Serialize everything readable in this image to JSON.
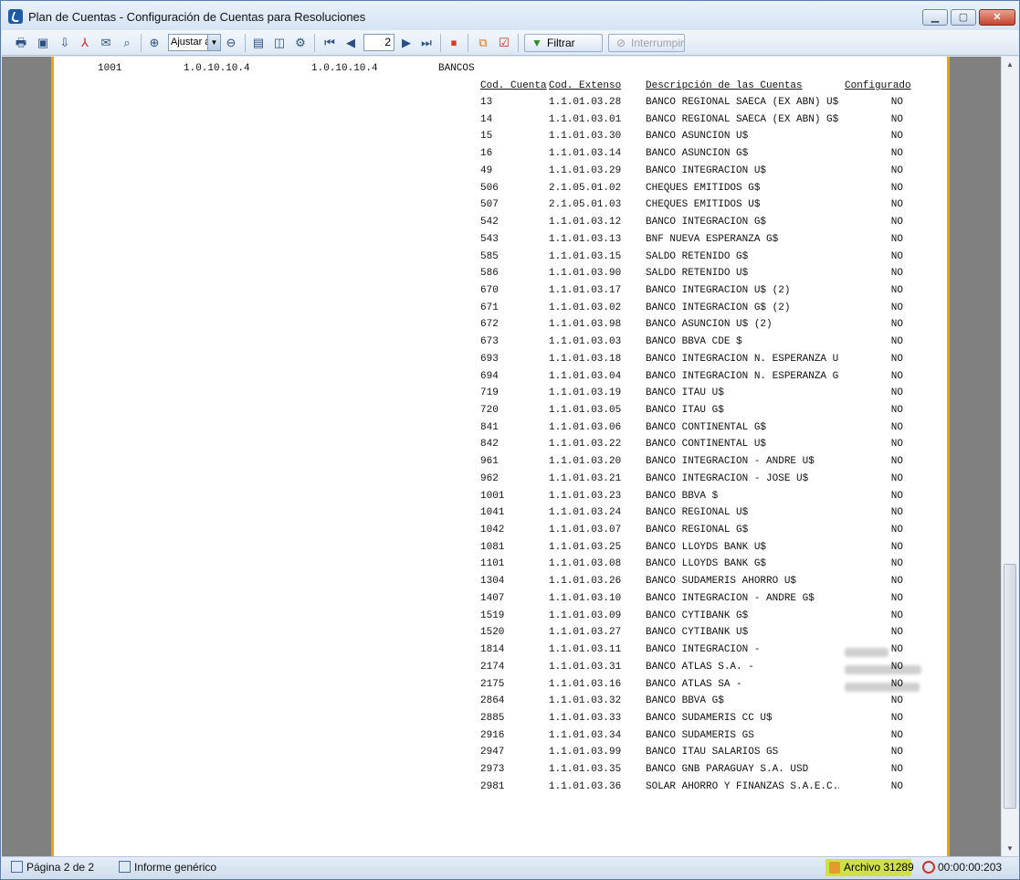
{
  "window": {
    "title": "Plan de Cuentas - Configuración de Cuentas para Resoluciones",
    "min_label": "▁",
    "max_label": "▢",
    "close_label": "✕"
  },
  "toolbar": {
    "zoom_value": "Ajustar a",
    "page_value": "2",
    "filter_label": "Filtrar",
    "interrupt_label": "Interrumpir",
    "icons": [
      "print-icon",
      "save-icon",
      "export-icon",
      "pdf-icon",
      "email-icon",
      "find-icon",
      "zoom-in-icon",
      "zoom-out-icon",
      "single-page-icon",
      "two-page-icon",
      "settings-icon",
      "first-page-icon",
      "previous-page-icon",
      "next-page-icon",
      "last-page-icon",
      "stop-icon",
      "copy-icon",
      "check-icon",
      "filter-icon",
      "interrupt-icon"
    ]
  },
  "report": {
    "group": {
      "code": "1001",
      "ext1": "1.0.10.10.4",
      "ext2": "1.0.10.10.4",
      "name": "BANCOS"
    },
    "headers": {
      "code": "Cod. Cuenta",
      "ext": "Cod. Extenso",
      "desc": "Descripción de las Cuentas",
      "conf": "Configurado"
    },
    "rows": [
      {
        "code": "13",
        "ext": "1.1.01.03.28",
        "desc": "BANCO REGIONAL SAECA (EX ABN) U$",
        "conf": "NO"
      },
      {
        "code": "14",
        "ext": "1.1.01.03.01",
        "desc": "BANCO REGIONAL SAECA (EX ABN) G$",
        "conf": "NO"
      },
      {
        "code": "15",
        "ext": "1.1.01.03.30",
        "desc": "BANCO ASUNCION U$",
        "conf": "NO"
      },
      {
        "code": "16",
        "ext": "1.1.01.03.14",
        "desc": "BANCO ASUNCION G$",
        "conf": "NO"
      },
      {
        "code": "49",
        "ext": "1.1.01.03.29",
        "desc": "BANCO INTEGRACION U$",
        "conf": "NO"
      },
      {
        "code": "506",
        "ext": "2.1.05.01.02",
        "desc": "CHEQUES EMITIDOS G$",
        "conf": "NO"
      },
      {
        "code": "507",
        "ext": "2.1.05.01.03",
        "desc": "CHEQUES EMITIDOS U$",
        "conf": "NO"
      },
      {
        "code": "542",
        "ext": "1.1.01.03.12",
        "desc": "BANCO INTEGRACION G$",
        "conf": "NO"
      },
      {
        "code": "543",
        "ext": "1.1.01.03.13",
        "desc": "BNF NUEVA ESPERANZA G$",
        "conf": "NO"
      },
      {
        "code": "585",
        "ext": "1.1.01.03.15",
        "desc": "SALDO RETENIDO G$",
        "conf": "NO"
      },
      {
        "code": "586",
        "ext": "1.1.01.03.90",
        "desc": "SALDO RETENIDO U$",
        "conf": "NO"
      },
      {
        "code": "670",
        "ext": "1.1.01.03.17",
        "desc": "BANCO INTEGRACION U$  (2)",
        "conf": "NO"
      },
      {
        "code": "671",
        "ext": "1.1.01.03.02",
        "desc": "BANCO INTEGRACION G$  (2)",
        "conf": "NO"
      },
      {
        "code": "672",
        "ext": "1.1.01.03.98",
        "desc": "BANCO ASUNCION U$  (2)",
        "conf": "NO"
      },
      {
        "code": "673",
        "ext": "1.1.01.03.03",
        "desc": "BANCO BBVA CDE $",
        "conf": "NO"
      },
      {
        "code": "693",
        "ext": "1.1.01.03.18",
        "desc": "BANCO INTEGRACION N. ESPERANZA U$",
        "conf": "NO"
      },
      {
        "code": "694",
        "ext": "1.1.01.03.04",
        "desc": "BANCO INTEGRACION N. ESPERANZA G$",
        "conf": "NO"
      },
      {
        "code": "719",
        "ext": "1.1.01.03.19",
        "desc": "BANCO ITAU U$",
        "conf": "NO"
      },
      {
        "code": "720",
        "ext": "1.1.01.03.05",
        "desc": "BANCO ITAU G$",
        "conf": "NO"
      },
      {
        "code": "841",
        "ext": "1.1.01.03.06",
        "desc": "BANCO CONTINENTAL G$",
        "conf": "NO"
      },
      {
        "code": "842",
        "ext": "1.1.01.03.22",
        "desc": "BANCO CONTINENTAL U$",
        "conf": "NO"
      },
      {
        "code": "961",
        "ext": "1.1.01.03.20",
        "desc": "BANCO INTEGRACION - ANDRE U$",
        "conf": "NO"
      },
      {
        "code": "962",
        "ext": "1.1.01.03.21",
        "desc": "BANCO INTEGRACION - JOSÉ U$",
        "conf": "NO"
      },
      {
        "code": "1001",
        "ext": "1.1.01.03.23",
        "desc": "BANCO BBVA $",
        "conf": "NO"
      },
      {
        "code": "1041",
        "ext": "1.1.01.03.24",
        "desc": "BANCO REGIONAL U$",
        "conf": "NO"
      },
      {
        "code": "1042",
        "ext": "1.1.01.03.07",
        "desc": "BANCO REGIONAL G$",
        "conf": "NO"
      },
      {
        "code": "1081",
        "ext": "1.1.01.03.25",
        "desc": "BANCO LLOYDS BANK U$",
        "conf": "NO"
      },
      {
        "code": "1101",
        "ext": "1.1.01.03.08",
        "desc": "BANCO LLOYDS BANK G$",
        "conf": "NO"
      },
      {
        "code": "1304",
        "ext": "1.1.01.03.26",
        "desc": "BANCO SUDAMERIS AHORRO U$",
        "conf": "NO"
      },
      {
        "code": "1407",
        "ext": "1.1.01.03.10",
        "desc": "BANCO INTEGRACION - ANDRE G$",
        "conf": "NO"
      },
      {
        "code": "1519",
        "ext": "1.1.01.03.09",
        "desc": "BANCO CYTIBANK G$",
        "conf": "NO"
      },
      {
        "code": "1520",
        "ext": "1.1.01.03.27",
        "desc": "BANCO CYTIBANK U$",
        "conf": "NO"
      },
      {
        "code": "1814",
        "ext": "1.1.01.03.11",
        "desc": "BANCO INTEGRACION -",
        "conf": "NO",
        "redacted": 1
      },
      {
        "code": "2174",
        "ext": "1.1.01.03.31",
        "desc": "BANCO ATLAS S.A. -",
        "conf": "NO",
        "redacted": 2
      },
      {
        "code": "2175",
        "ext": "1.1.01.03.16",
        "desc": "BANCO ATLAS SA -",
        "conf": "NO",
        "redacted": 3
      },
      {
        "code": "2864",
        "ext": "1.1.01.03.32",
        "desc": "BANCO BBVA G$",
        "conf": "NO"
      },
      {
        "code": "2885",
        "ext": "1.1.01.03.33",
        "desc": "BANCO SUDAMERIS CC U$",
        "conf": "NO"
      },
      {
        "code": "2916",
        "ext": "1.1.01.03.34",
        "desc": "BANCO SUDAMERIS GS",
        "conf": "NO"
      },
      {
        "code": "2947",
        "ext": "1.1.01.03.99",
        "desc": "BANCO ITAU SALARIOS GS",
        "conf": "NO"
      },
      {
        "code": "2973",
        "ext": "1.1.01.03.35",
        "desc": "BANCO GNB PARAGUAY S.A. USD",
        "conf": "NO"
      },
      {
        "code": "2981",
        "ext": "1.1.01.03.36",
        "desc": "SOLAR AHORRO Y FINANZAS S.A.E.C.A. U",
        "conf": "NO"
      }
    ]
  },
  "statusbar": {
    "page_label": "Página 2 de 2",
    "report_label": "Informe genérico",
    "archivo_label": "Archivo 31289",
    "timer_label": "00:00:00:203"
  },
  "colors": {
    "page_border": "#e8a417",
    "archivo_highlight": "#cfe04b",
    "viewer_background": "#808080"
  }
}
